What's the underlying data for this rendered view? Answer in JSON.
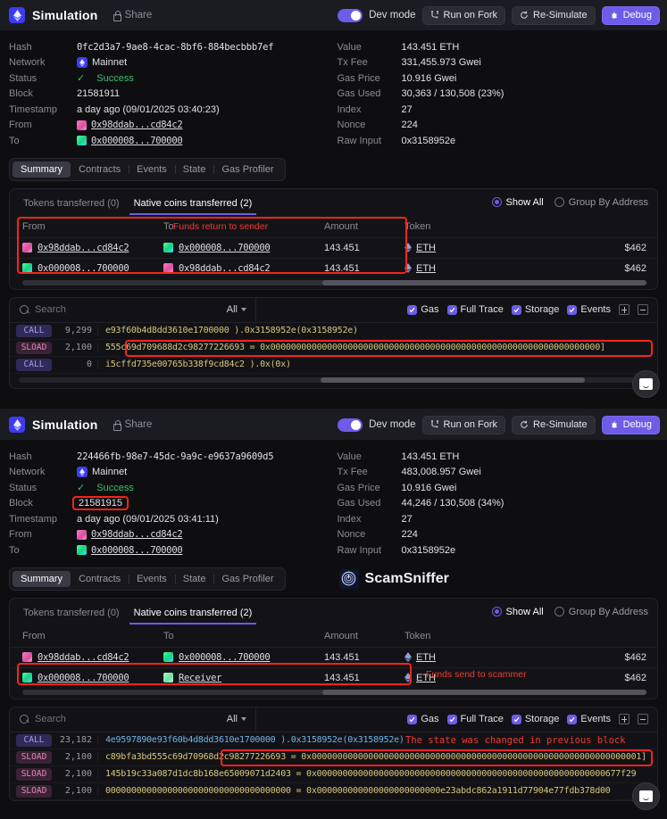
{
  "header": {
    "title": "Simulation",
    "share_label": "Share",
    "dev_mode_label": "Dev mode",
    "run_on_fork_label": "Run on Fork",
    "resimulate_label": "Re-Simulate",
    "debug_label": "Debug",
    "accent": "#6c5ce7"
  },
  "labels": {
    "hash": "Hash",
    "network": "Network",
    "status": "Status",
    "block": "Block",
    "timestamp": "Timestamp",
    "from": "From",
    "to": "To",
    "value": "Value",
    "tx_fee": "Tx Fee",
    "gas_price": "Gas Price",
    "gas_used": "Gas Used",
    "index": "Index",
    "nonce": "Nonce",
    "raw_input": "Raw Input"
  },
  "tabs": [
    "Summary",
    "Contracts",
    "Events",
    "State",
    "Gas Profiler"
  ],
  "subtabs": [
    "Tokens transferred (0)",
    "Native coins transferred (2)"
  ],
  "filters": {
    "show_all": "Show All",
    "group_by_address": "Group By Address"
  },
  "table_headers": {
    "from": "From",
    "to": "To",
    "amount": "Amount",
    "token": "Token"
  },
  "trace_bar": {
    "search_placeholder": "Search",
    "filter_value": "All",
    "gas": "Gas",
    "full_trace": "Full Trace",
    "storage": "Storage",
    "events": "Events"
  },
  "logo": {
    "text": "ScamSniffer"
  },
  "panel1": {
    "hash": "0fc2d3a7-9ae8-4cac-8bf6-884becbbb7ef",
    "network": "Mainnet",
    "status": "Success",
    "block": "21581911",
    "timestamp": "a day ago (09/01/2025 03:40:23)",
    "from": "0x98ddab...cd84c2",
    "to": "0x000008...700000",
    "value": "143.451 ETH",
    "tx_fee": "331,455.973 Gwei",
    "gas_price": "10.916 Gwei",
    "gas_used": "30,363 / 130,508 (23%)",
    "index": "27",
    "nonce": "224",
    "raw_input": "0x3158952e",
    "annotation": "Funds return to sender",
    "transfers": [
      {
        "from": "0x98ddab...cd84c2",
        "from_av": "pink",
        "to": "0x000008...700000",
        "to_av": "green",
        "amount": "143.451",
        "token": "ETH",
        "usd": "$462"
      },
      {
        "from": "0x000008...700000",
        "from_av": "green",
        "to": "0x98ddab...cd84c2",
        "to_av": "pink",
        "amount": "143.451",
        "token": "ETH",
        "usd": "$462"
      }
    ],
    "trace": [
      {
        "op": "CALL",
        "gas": "9,299",
        "text": "e93f60b4d8dd3610e1700000 ).0x3158952e(0x3158952e)"
      },
      {
        "op": "SLOAD",
        "gas": "2,100",
        "text": "555c69d709688d2c98277226693 = 0x0000000000000000000000000000000000000000000000000000000000000000]"
      },
      {
        "op": "CALL",
        "gas": "0",
        "text": "i5cffd735e00765b338f9cd84c2 ).0x(0x)"
      }
    ]
  },
  "panel2": {
    "hash": "224466fb-98e7-45dc-9a9c-e9637a9609d5",
    "network": "Mainnet",
    "status": "Success",
    "block": "21581915",
    "timestamp": "a day ago (09/01/2025 03:41:11)",
    "from": "0x98ddab...cd84c2",
    "to": "0x000008...700000",
    "value": "143.451 ETH",
    "tx_fee": "483,008.957 Gwei",
    "gas_price": "10.916 Gwei",
    "gas_used": "44,246 / 130,508 (34%)",
    "index": "27",
    "nonce": "224",
    "raw_input": "0x3158952e",
    "annotation": "Funds send to scammer",
    "trace_annotation": "The state was changed in previous block",
    "transfers": [
      {
        "from": "0x98ddab...cd84c2",
        "from_av": "pink",
        "to": "0x000008...700000",
        "to_av": "green",
        "amount": "143.451",
        "token": "ETH",
        "usd": "$462"
      },
      {
        "from": "0x000008...700000",
        "from_av": "green",
        "to": "Receiver",
        "to_av": "mint",
        "amount": "143.451",
        "token": "ETH",
        "usd": "$462"
      }
    ],
    "trace": [
      {
        "op": "CALL",
        "gas": "23,182",
        "text": "4e9597890e93f60b4d8dd3610e1700000 ).0x3158952e(0x3158952e)"
      },
      {
        "op": "SLOAD",
        "gas": "2,100",
        "text": "c89bfa3bd555c69d70968d2c98277226693 = 0x0000000000000000000000000000000000000000000000000000000000000001]"
      },
      {
        "op": "SLOAD",
        "gas": "2,100",
        "text": "145b19c33a087d1dc8b168e65009071d2403 = 0x00000000000000000000000000000000000000000000000000000000677f29"
      },
      {
        "op": "SLOAD",
        "gas": "2,100",
        "text": "000000000000000000000000000000000000 = 0x000000000000000000000000e23abdc862a1911d77904e77fdb378d00"
      }
    ]
  }
}
